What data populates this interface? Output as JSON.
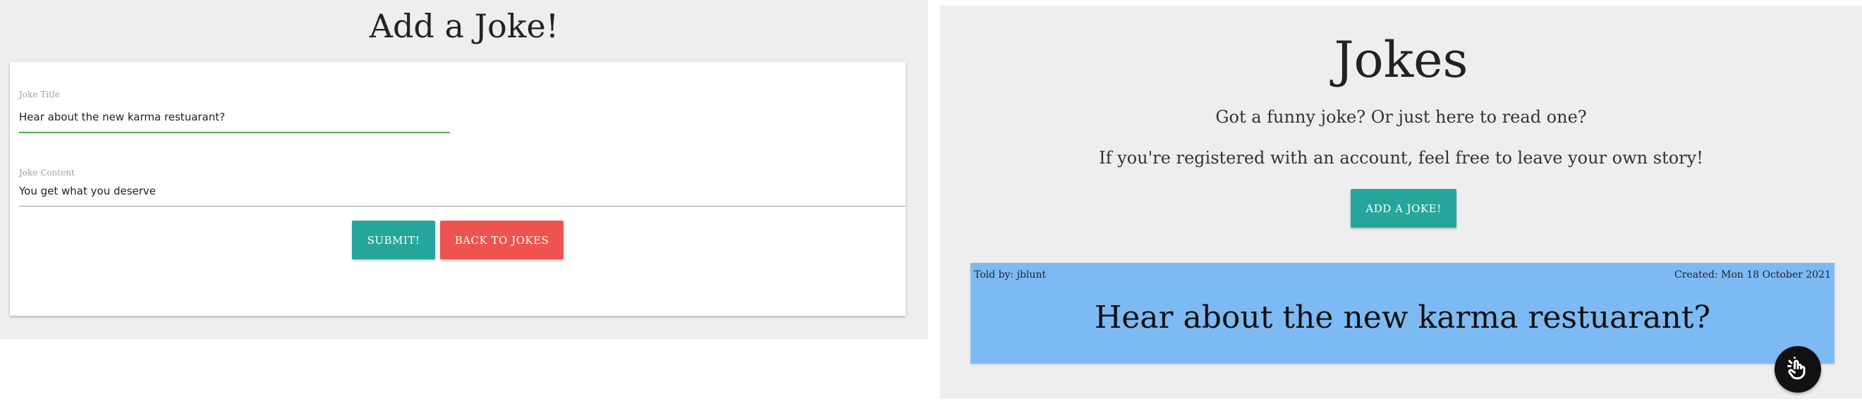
{
  "add_page": {
    "title": "Add a Joke!",
    "form": {
      "title_label": "Joke Title",
      "title_value": "Hear about the new karma restuarant?",
      "content_label": "Joke Content",
      "content_value": "You get what you deserve"
    },
    "buttons": {
      "submit": "SUBMIT!",
      "back": "BACK TO JOKES"
    }
  },
  "jokes_page": {
    "title": "Jokes",
    "tagline_1": "Got a funny joke? Or just here to read one?",
    "tagline_2": "If you're registered with an account, feel free to leave your own story!",
    "add_button": "ADD A JOKE!",
    "joke": {
      "told_by": "Told by: jblunt",
      "created": "Created: Mon 18 October 2021",
      "title": "Hear about the new karma restuarant?"
    },
    "fab_icon": "pointer-hand-icon"
  },
  "colors": {
    "teal": "#26a69a",
    "red": "#ef5350",
    "card_blue": "#7dbaf3",
    "focus_green": "#4caf50",
    "panel_gray": "#eeeeee"
  }
}
